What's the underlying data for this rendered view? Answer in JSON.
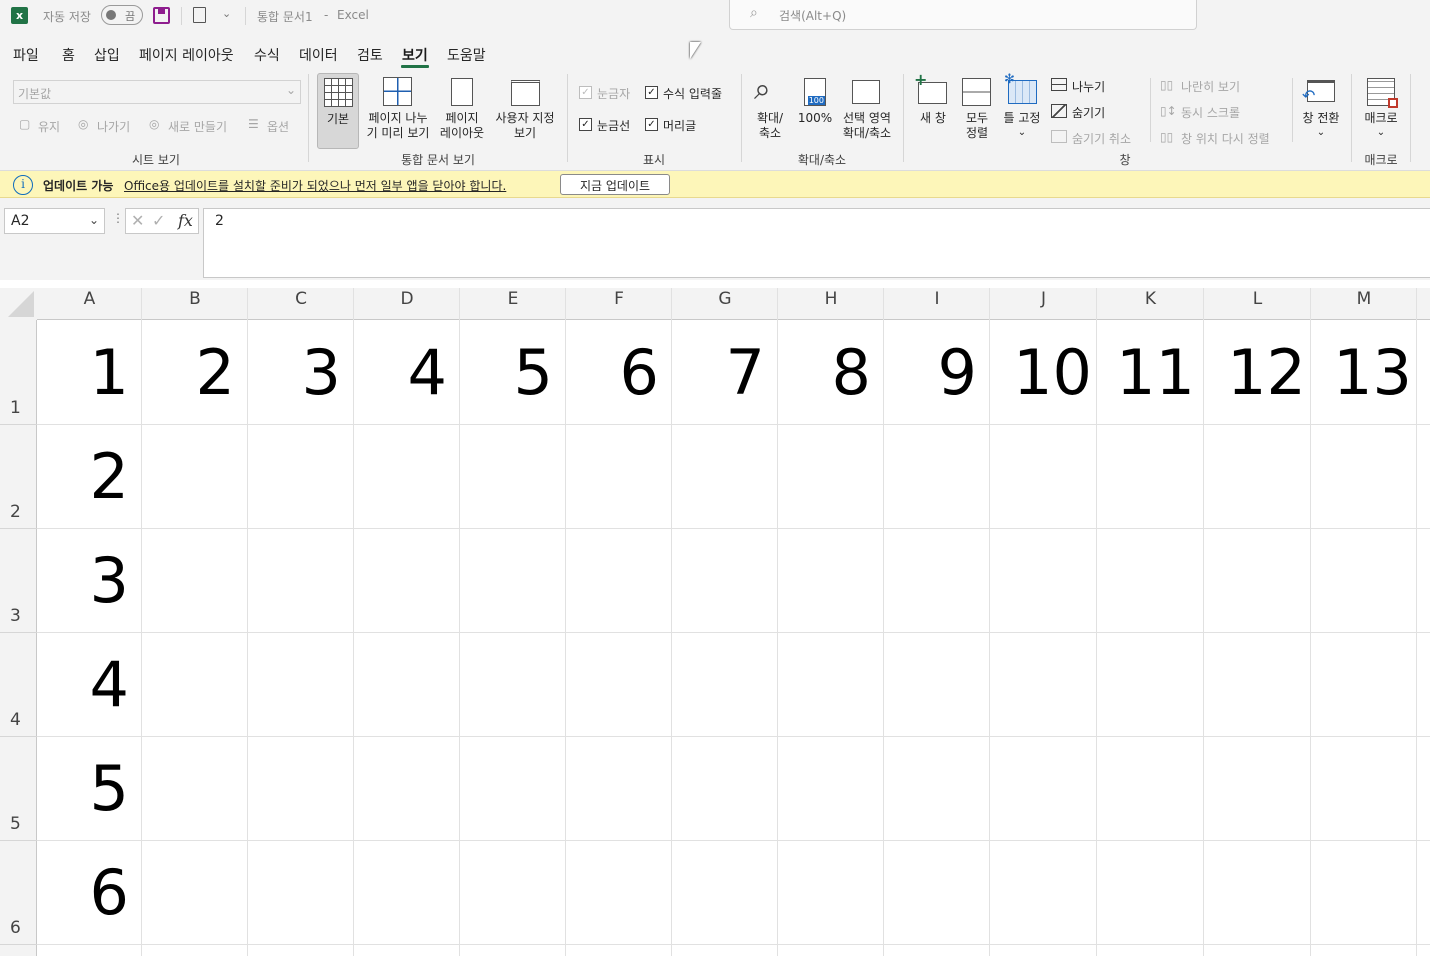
{
  "titlebar": {
    "autosave_label": "자동 저장",
    "autosave_state": "끔",
    "document_title": "통합 문서1",
    "separator": "-",
    "app_name": "Excel",
    "search_placeholder": "검색(Alt+Q)"
  },
  "tabs": [
    {
      "label": "파일",
      "active": false
    },
    {
      "label": "홈",
      "active": false
    },
    {
      "label": "삽입",
      "active": false
    },
    {
      "label": "페이지 레이아웃",
      "active": false
    },
    {
      "label": "수식",
      "active": false
    },
    {
      "label": "데이터",
      "active": false
    },
    {
      "label": "검토",
      "active": false
    },
    {
      "label": "보기",
      "active": true
    },
    {
      "label": "도움말",
      "active": false
    }
  ],
  "ribbon": {
    "sheet_view": {
      "dropdown_value": "기본값",
      "keep": "유지",
      "exit": "나가기",
      "new": "새로 만들기",
      "options": "옵션",
      "group_label": "시트 보기"
    },
    "workbook_views": {
      "normal": "기본",
      "page_break_line1": "페이지 나누",
      "page_break_line2": "기 미리 보기",
      "page_layout_line1": "페이지",
      "page_layout_line2": "레이아웃",
      "custom_line1": "사용자 지정",
      "custom_line2": "보기",
      "group_label": "통합 문서 보기"
    },
    "show": {
      "ruler": "눈금자",
      "formula_bar": "수식 입력줄",
      "gridlines": "눈금선",
      "headings": "머리글",
      "group_label": "표시"
    },
    "zoom": {
      "zoom_line1": "확대/",
      "zoom_line2": "축소",
      "hundred": "100%",
      "hundred_icon": "100",
      "selection_line1": "선택 영역",
      "selection_line2": "확대/축소",
      "group_label": "확대/축소"
    },
    "window": {
      "new_window": "새 창",
      "arrange_line1": "모두",
      "arrange_line2": "정렬",
      "freeze": "틀 고정",
      "split": "나누기",
      "hide": "숨기기",
      "unhide": "숨기기 취소",
      "side_by_side": "나란히 보기",
      "sync_scroll": "동시 스크롤",
      "reset_position": "창 위치 다시 정렬",
      "switch": "창 전환",
      "group_label": "창"
    },
    "macros": {
      "macros": "매크로",
      "group_label": "매크로"
    }
  },
  "message_bar": {
    "title": "업데이트 가능",
    "message": "Office용 업데이트를 설치할 준비가 되었으나 먼저 일부 앱을 닫아야 합니다.",
    "button": "지금 업데이트"
  },
  "formula_bar": {
    "name_box": "A2",
    "fx_label": "fx",
    "value": "2"
  },
  "grid": {
    "columns": [
      "A",
      "B",
      "C",
      "D",
      "E",
      "F",
      "G",
      "H",
      "I",
      "J",
      "K",
      "L",
      "M"
    ],
    "rows": [
      "1",
      "2",
      "3",
      "4",
      "5",
      "6"
    ],
    "row1_values": [
      "1",
      "2",
      "3",
      "4",
      "5",
      "6",
      "7",
      "8",
      "9",
      "10",
      "11",
      "12",
      "13"
    ],
    "colA_values": [
      "2",
      "3",
      "4",
      "5",
      "6"
    ]
  },
  "colors": {
    "excel_green": "#217346",
    "save_purple": "#8e1d8e",
    "message_bg": "#fdf6b9",
    "info_blue": "#0f6cbd"
  }
}
